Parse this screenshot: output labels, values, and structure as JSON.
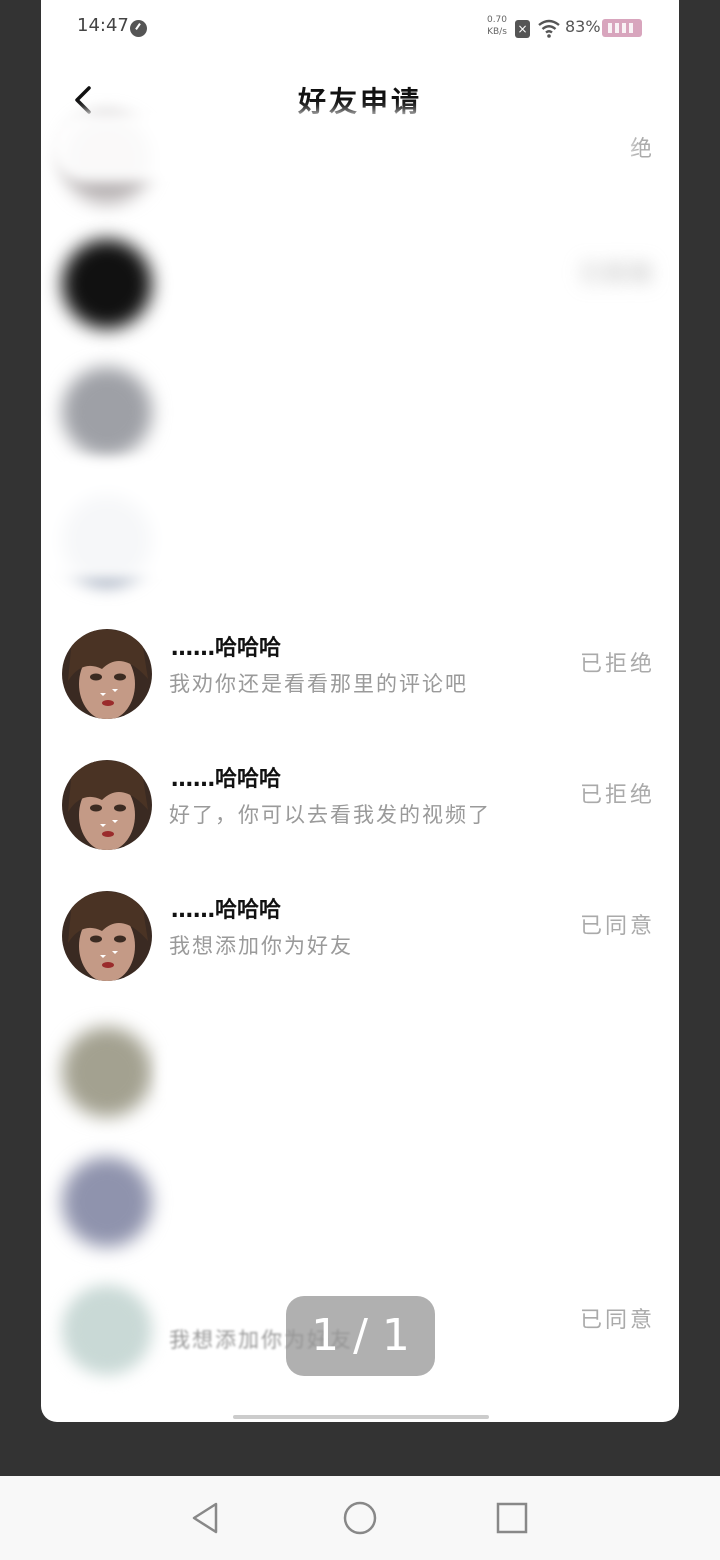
{
  "status_bar": {
    "time": "14:47",
    "net_speed_value": "0.70",
    "net_speed_unit": "KB/s",
    "battery": "83%",
    "icons": [
      "clock-icon",
      "close-badge-icon",
      "wifi-icon",
      "battery-icon"
    ]
  },
  "header": {
    "title": "好友申请",
    "back_icon": "chevron-left-icon"
  },
  "requests": [
    {
      "name": "",
      "message": "",
      "status": "绝",
      "blurred": true
    },
    {
      "name": "",
      "message": "",
      "status": "已拒绝",
      "blurred": true
    },
    {
      "name": "",
      "message": "",
      "status": "",
      "blurred": true
    },
    {
      "name": "",
      "message": "",
      "status": "",
      "blurred": true
    },
    {
      "name": "……哈哈哈",
      "message": "我劝你还是看看那里的评论吧",
      "status": "已拒绝",
      "blurred": false
    },
    {
      "name": "……哈哈哈",
      "message": "好了，你可以去看我发的视频了",
      "status": "已拒绝",
      "blurred": false
    },
    {
      "name": "……哈哈哈",
      "message": "我想添加你为好友",
      "status": "已同意",
      "blurred": false
    },
    {
      "name": "",
      "message": "",
      "status": "",
      "blurred": true
    },
    {
      "name": "",
      "message": "",
      "status": "",
      "blurred": true
    },
    {
      "name": "",
      "message": "我想添加你为好友",
      "status": "已同意",
      "blurred": true
    }
  ],
  "page_counter": "1 / 1",
  "nav_bar": {
    "back": "triangle-back-icon",
    "home": "circle-home-icon",
    "recents": "square-recents-icon"
  },
  "colors": {
    "background": "#333333",
    "card": "#ffffff",
    "status_text": "#aaaaaa",
    "message_text": "#9a9a9a"
  }
}
